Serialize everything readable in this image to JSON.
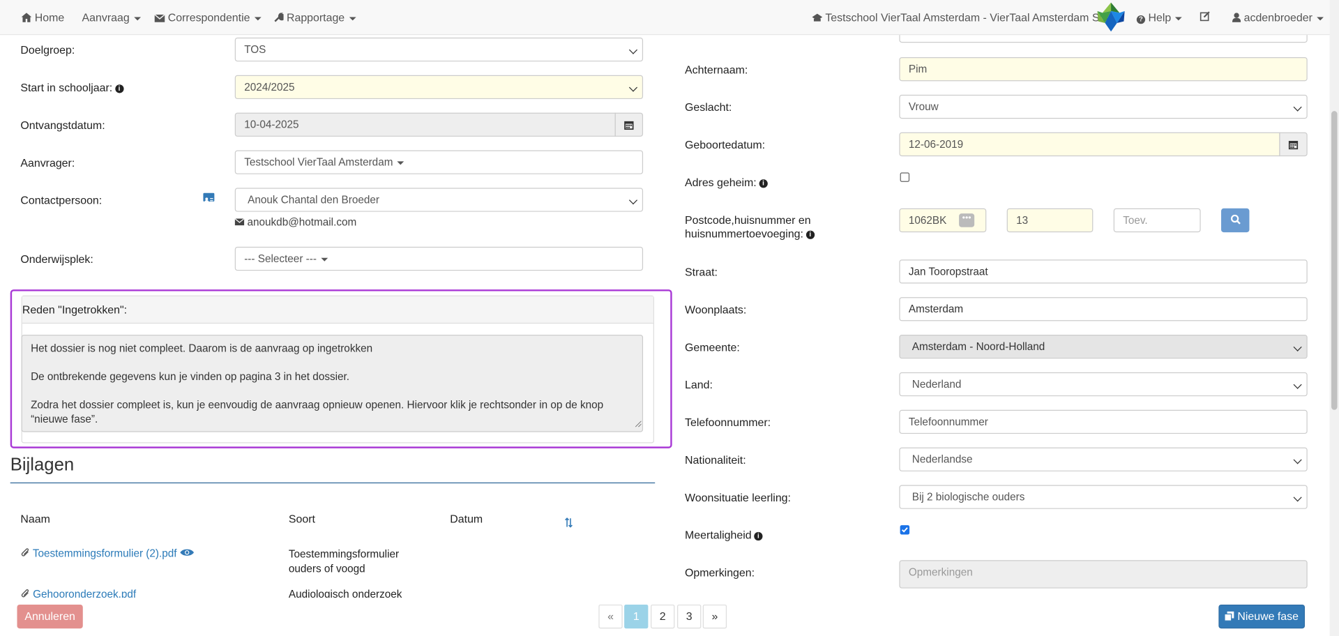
{
  "nav": {
    "home": "Home",
    "aanvraag": "Aanvraag",
    "correspondentie": "Correspondentie",
    "rapportage": "Rapportage",
    "school": "Testschool VierTaal Amsterdam - VierTaal Amsterdam SO",
    "help": "Help",
    "user": "acdenbroeder"
  },
  "left": {
    "doelgroep_label": "Doelgroep:",
    "doelgroep_value": "TOS",
    "start_label": "Start in schooljaar:",
    "start_value": "2024/2025",
    "ontvangst_label": "Ontvangstdatum:",
    "ontvangst_value": "10-04-2025",
    "aanvrager_label": "Aanvrager:",
    "aanvrager_value": "Testschool VierTaal Amsterdam",
    "contact_label": "Contactpersoon:",
    "contact_value": "Anouk Chantal den Broeder",
    "contact_email": "anoukdb@hotmail.com",
    "onderwijsplek_label": "Onderwijsplek:",
    "onderwijsplek_value": "--- Selecteer ---"
  },
  "reden": {
    "title": "Reden \"Ingetrokken\":",
    "line1": "Het dossier is nog niet compleet. Daarom is de aanvraag op  ingetrokken",
    "line2": "De ontbrekende gegevens kun je vinden op pagina 3 in het dossier.",
    "line3": "Zodra het dossier compleet is, kun je eenvoudig de aanvraag opnieuw openen. Hiervoor klik je rechtsonder in op de knop “nieuwe fase”."
  },
  "bijlagen": {
    "title": "Bijlagen",
    "columns": [
      "Naam",
      "Soort",
      "Datum"
    ],
    "rows": [
      {
        "naam": "Toestemmingsformulier (2).pdf",
        "soort": "Toestemmingsformulier ouders of voogd"
      },
      {
        "naam": "Gehooronderzoek.pdf",
        "soort": "Audiologisch onderzoek"
      }
    ]
  },
  "right": {
    "achternaam_label": "Achternaam:",
    "achternaam_value": "Pim",
    "geslacht_label": "Geslacht:",
    "geslacht_value": "Vrouw",
    "geboorte_label": "Geboortedatum:",
    "geboorte_value": "12-06-2019",
    "adres_label": "Adres geheim:",
    "postcode_label_1": "Postcode,huisnummer en",
    "postcode_label_2": "huisnummertoevoeging:",
    "postcode_value": "1062BK",
    "huisnummer_value": "13",
    "toev_placeholder": "Toev.",
    "straat_label": "Straat:",
    "straat_value": "Jan Tooropstraat",
    "woonplaats_label": "Woonplaats:",
    "woonplaats_value": "Amsterdam",
    "gemeente_label": "Gemeente:",
    "gemeente_value": "Amsterdam - Noord-Holland",
    "land_label": "Land:",
    "land_value": "Nederland",
    "telefoon_label": "Telefoonnummer:",
    "telefoon_placeholder": "Telefoonnummer",
    "nationaliteit_label": "Nationaliteit:",
    "nationaliteit_value": "Nederlandse",
    "woonsituatie_label": "Woonsituatie leerling:",
    "woonsituatie_value": "Bij 2 biologische ouders",
    "meertalig_label": "Meertaligheid",
    "opmerkingen_label": "Opmerkingen:",
    "opmerkingen_placeholder": "Opmerkingen"
  },
  "footer": {
    "annuleren": "Annuleren",
    "prev": "«",
    "pages": [
      "1",
      "2",
      "3"
    ],
    "next": "»",
    "nieuwe_fase": "Nieuwe fase"
  },
  "colors": {
    "accent_border": "#a93ad6",
    "primary": "#337ab7",
    "danger": "#d9534f"
  }
}
